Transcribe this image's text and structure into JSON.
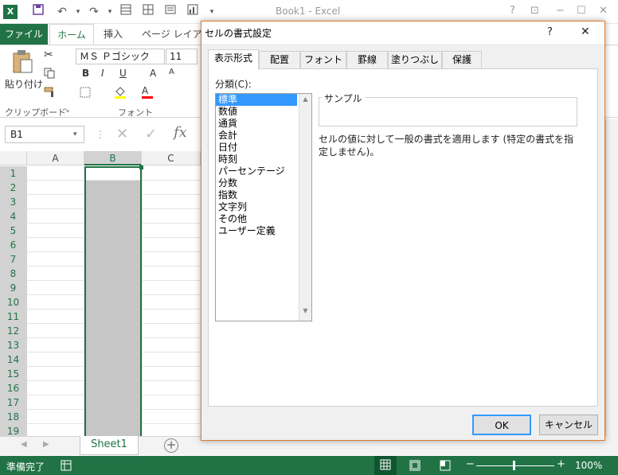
{
  "app": {
    "title": "Book1 - Excel",
    "logo_letter": "X",
    "help": "?",
    "minimize": "−",
    "maximize": "☐",
    "close": "✕"
  },
  "ribbon_tabs": {
    "file": "ファイル",
    "home": "ホーム",
    "insert": "挿入",
    "page_layout": "ページ レイアウト"
  },
  "ribbon": {
    "paste_label": "貼り付け",
    "clipboard_group": "クリップボード",
    "font_group": "フォント",
    "font_name": "ＭＳ Ｐゴシック",
    "font_size": "11",
    "bold": "B",
    "italic": "I",
    "underline": "U",
    "grow_font": "A",
    "shrink_font": "A",
    "font_color": "A"
  },
  "formula_bar": {
    "name_box": "B1",
    "fx": "fx"
  },
  "grid": {
    "columns": [
      "A",
      "B",
      "C"
    ],
    "rows": [
      "1",
      "2",
      "3",
      "4",
      "5",
      "6",
      "7",
      "8",
      "9",
      "10",
      "11",
      "12",
      "13",
      "14",
      "15",
      "16",
      "17",
      "18",
      "19"
    ]
  },
  "sheets": {
    "active": "Sheet1"
  },
  "status": {
    "ready": "準備完了",
    "zoom": "100%"
  },
  "dialog": {
    "title": "セルの書式設定",
    "help": "?",
    "close": "✕",
    "tabs": [
      "表示形式",
      "配置",
      "フォント",
      "罫線",
      "塗りつぶし",
      "保護"
    ],
    "category_label": "分類(C):",
    "categories": [
      "標準",
      "数値",
      "通貨",
      "会計",
      "日付",
      "時刻",
      "パーセンテージ",
      "分数",
      "指数",
      "文字列",
      "その他",
      "ユーザー定義"
    ],
    "selected_category": "標準",
    "sample_label": "サンプル",
    "description": "セルの値に対して一般の書式を適用します (特定の書式を指定しません)。",
    "ok": "OK",
    "cancel": "キャンセル"
  },
  "colors": {
    "excel_green": "#217346",
    "selection_fill": "#c6c6c6",
    "dialog_border": "#e07a2a",
    "list_selection": "#3399ff"
  }
}
